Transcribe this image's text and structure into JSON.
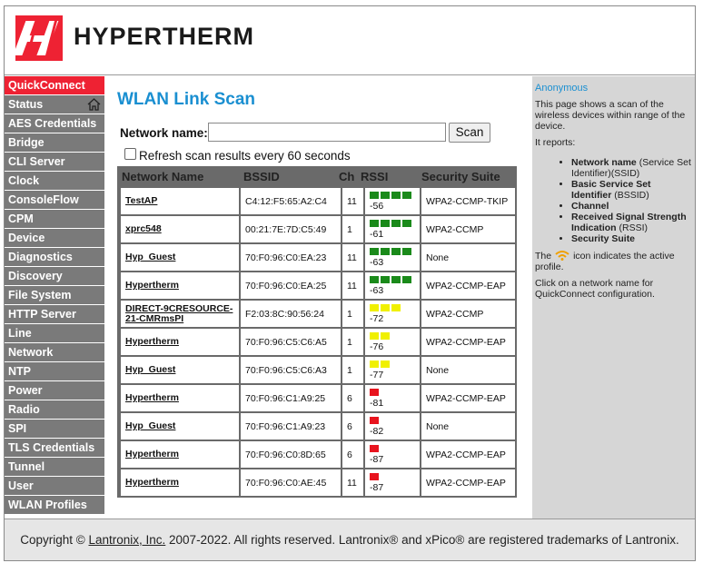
{
  "brand": {
    "logo_text": "HYPERTHERM",
    "primary_color": "#ee2233",
    "accent_color": "#1a8fd1"
  },
  "sidebar": {
    "items": [
      {
        "label": "QuickConnect",
        "active": true
      },
      {
        "label": "Status",
        "icon": "home-icon"
      },
      {
        "label": "AES Credentials"
      },
      {
        "label": "Bridge"
      },
      {
        "label": "CLI Server"
      },
      {
        "label": "Clock"
      },
      {
        "label": "ConsoleFlow"
      },
      {
        "label": "CPM"
      },
      {
        "label": "Device"
      },
      {
        "label": "Diagnostics"
      },
      {
        "label": "Discovery"
      },
      {
        "label": "File System"
      },
      {
        "label": "HTTP Server"
      },
      {
        "label": "Line"
      },
      {
        "label": "Network"
      },
      {
        "label": "NTP"
      },
      {
        "label": "Power"
      },
      {
        "label": "Radio"
      },
      {
        "label": "SPI"
      },
      {
        "label": "TLS Credentials"
      },
      {
        "label": "Tunnel"
      },
      {
        "label": "User"
      },
      {
        "label": "WLAN Profiles"
      }
    ]
  },
  "main": {
    "title": "WLAN Link Scan",
    "network_name_label": "Network name:",
    "network_name_value": "",
    "scan_label": "Scan",
    "refresh_label": "Refresh scan results every 60 seconds",
    "refresh_checked": false,
    "table": {
      "headers": {
        "name": "Network Name",
        "bssid": "BSSID",
        "ch": "Ch",
        "rssi": "RSSI",
        "security": "Security Suite"
      },
      "rows": [
        {
          "name": "TestAP",
          "bssid": "C4:12:F5:65:A2:C4",
          "ch": "11",
          "rssi": "-56",
          "bars": 4,
          "level": "green",
          "security": "WPA2-CCMP-TKIP"
        },
        {
          "name": "xprc548",
          "bssid": "00:21:7E:7D:C5:49",
          "ch": "1",
          "rssi": "-61",
          "bars": 4,
          "level": "green",
          "security": "WPA2-CCMP"
        },
        {
          "name": "Hyp_Guest",
          "bssid": "70:F0:96:C0:EA:23",
          "ch": "11",
          "rssi": "-63",
          "bars": 4,
          "level": "green",
          "security": "None"
        },
        {
          "name": "Hypertherm",
          "bssid": "70:F0:96:C0:EA:25",
          "ch": "11",
          "rssi": "-63",
          "bars": 4,
          "level": "green",
          "security": "WPA2-CCMP-EAP"
        },
        {
          "name": "DIRECT-9CRESOURCE-21-CMRmsPI",
          "bssid": "F2:03:8C:90:56:24",
          "ch": "1",
          "rssi": "-72",
          "bars": 3,
          "level": "yellow",
          "security": "WPA2-CCMP"
        },
        {
          "name": "Hypertherm",
          "bssid": "70:F0:96:C5:C6:A5",
          "ch": "1",
          "rssi": "-76",
          "bars": 2,
          "level": "yellow",
          "security": "WPA2-CCMP-EAP"
        },
        {
          "name": "Hyp_Guest",
          "bssid": "70:F0:96:C5:C6:A3",
          "ch": "1",
          "rssi": "-77",
          "bars": 2,
          "level": "yellow",
          "security": "None"
        },
        {
          "name": "Hypertherm",
          "bssid": "70:F0:96:C1:A9:25",
          "ch": "6",
          "rssi": "-81",
          "bars": 1,
          "level": "red",
          "security": "WPA2-CCMP-EAP"
        },
        {
          "name": "Hyp_Guest",
          "bssid": "70:F0:96:C1:A9:23",
          "ch": "6",
          "rssi": "-82",
          "bars": 1,
          "level": "red",
          "security": "None"
        },
        {
          "name": "Hypertherm",
          "bssid": "70:F0:96:C0:8D:65",
          "ch": "6",
          "rssi": "-87",
          "bars": 1,
          "level": "red",
          "security": "WPA2-CCMP-EAP"
        },
        {
          "name": "Hypertherm",
          "bssid": "70:F0:96:C0:AE:45",
          "ch": "11",
          "rssi": "-87",
          "bars": 1,
          "level": "red",
          "security": "WPA2-CCMP-EAP"
        }
      ]
    },
    "signal_colors": {
      "green": "#1a8a1a",
      "yellow": "#f0f000",
      "red": "#e8141e"
    }
  },
  "help": {
    "user": "Anonymous",
    "intro": "This page shows a scan of the wireless devices within range of the device.",
    "reports_label": "It reports:",
    "items": [
      {
        "bold": "Network name",
        "rest": " (Service Set Identifier)(SSID)"
      },
      {
        "bold": "Basic Service Set Identifier",
        "rest": " (BSSID)"
      },
      {
        "bold": "Channel",
        "rest": ""
      },
      {
        "bold": "Received Signal Strength Indication",
        "rest": " (RSSI)"
      },
      {
        "bold": "Security Suite",
        "rest": ""
      }
    ],
    "icon_note_before": "The",
    "icon_note_after": "icon indicates the active profile.",
    "click_note": "Click on a network name for QuickConnect configuration."
  },
  "footer": {
    "before": "Copyright © ",
    "link": "Lantronix, Inc.",
    "after": " 2007-2022. All rights reserved. Lantronix® and xPico® are registered trademarks of Lantronix."
  }
}
